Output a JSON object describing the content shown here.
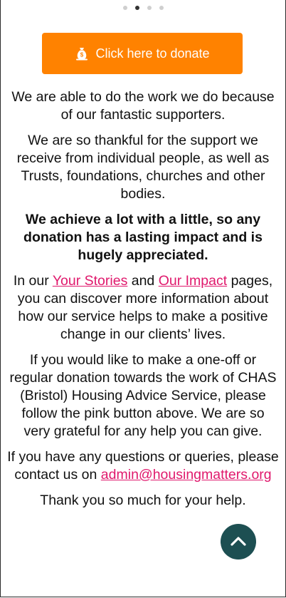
{
  "carousel": {
    "dot_count": 4,
    "active_index": 1
  },
  "donate": {
    "label": "Click here to donate",
    "icon": "money-bag-icon",
    "color": "#ff8200"
  },
  "paragraphs": {
    "p1": "We are able to do the work we do because of our fantastic supporters.",
    "p2": "We are so thankful for the support we receive from individual people, as well as Trusts, foundations, churches and other bodies.",
    "p3": "We achieve a lot with a little, so any donation has a lasting impact and is hugely appreciated.",
    "p4_before": "In our ",
    "p4_link1": "Your Stories",
    "p4_mid": " and ",
    "p4_link2": "Our Impact",
    "p4_after": " pages, you can discover more information about how our service helps to make a positive change in our clients’ lives.",
    "p5": "If you would like to make a one-off or regular donation towards the work of CHAS (Bristol) Housing Advice Service, please follow the pink button above. We are so very grateful for any help you can give.",
    "p6_before": "If you have any questions or queries, please contact us on ",
    "p6_email": "admin@housingmatters.org",
    "p7": "Thank you so much for your help."
  },
  "colors": {
    "link": "#e0186c",
    "scroll_button": "#1d4f52"
  },
  "scroll_top": {
    "icon": "chevron-up-icon"
  }
}
